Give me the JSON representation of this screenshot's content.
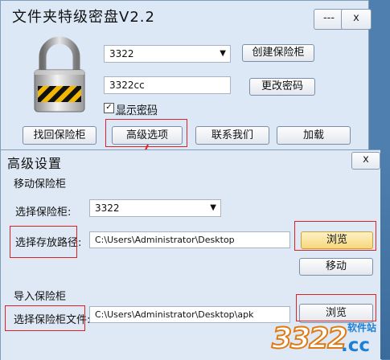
{
  "main_window": {
    "title": "文件夹特级密盘V2.2",
    "minimize_label": "---",
    "close_label": "x",
    "vault_select_value": "3322",
    "password_value": "3322cc",
    "create_button": "创建保险柜",
    "change_password_button": "更改密码",
    "show_password_label": "显示密码",
    "show_password_checked": "✓",
    "buttons": {
      "recover": "找回保险柜",
      "advanced": "高级选项",
      "contact": "联系我们",
      "uninstall": "加载"
    }
  },
  "advanced_window": {
    "title": "高级设置",
    "close_label": "x",
    "move_section": {
      "heading": "移动保险柜",
      "select_label": "选择保险柜:",
      "select_value": "3322",
      "path_label": "选择存放路径:",
      "path_value": "C:\\Users\\Administrator\\Desktop",
      "browse_button": "浏览",
      "move_button": "移动"
    },
    "import_section": {
      "heading": "导入保险柜",
      "file_label": "选择保险柜文件:",
      "file_value": "C:\\Users\\Administrator\\Desktop\\apk",
      "browse_button": "浏览"
    }
  },
  "watermark": {
    "brand": "3322",
    "suffix": ".cc",
    "tag": "软件站"
  },
  "colors": {
    "highlight": "#dd2222",
    "window_bg": "#dce8f6",
    "desktop": "#4f7fae"
  }
}
